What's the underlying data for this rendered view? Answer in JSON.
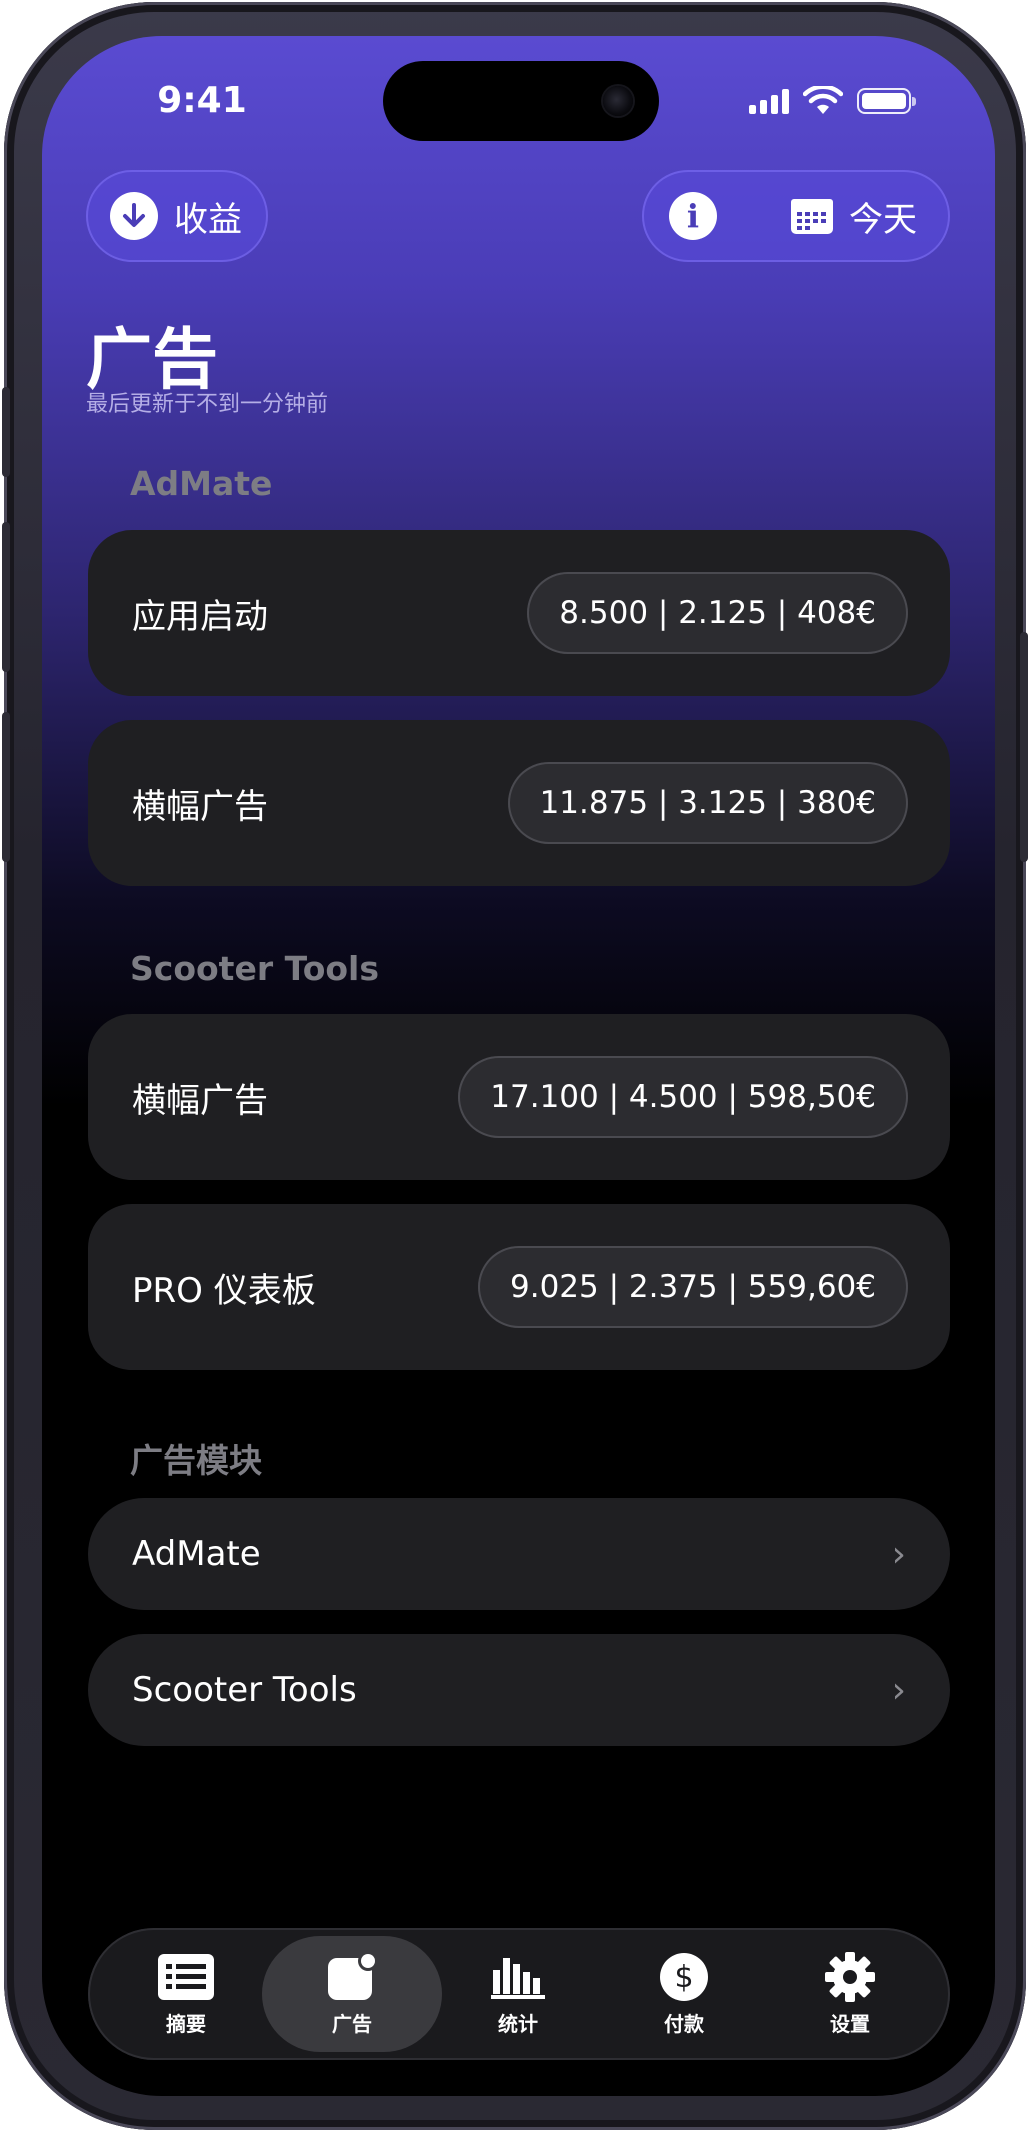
{
  "status_bar": {
    "time": "9:41"
  },
  "header": {
    "earnings_button": "收益",
    "info_button_icon": "info-icon",
    "date_button": "今天",
    "title": "广告",
    "subtitle": "最后更新于不到一分钟前"
  },
  "sections": [
    {
      "title": "AdMate",
      "rows": [
        {
          "label": "应用启动",
          "value": "8.500 | 2.125 | 408€"
        },
        {
          "label": "横幅广告",
          "value": "11.875 | 3.125 | 380€"
        }
      ]
    },
    {
      "title": "Scooter Tools",
      "rows": [
        {
          "label": "横幅广告",
          "value": "17.100 | 4.500 | 598,50€"
        },
        {
          "label": "PRO 仪表板",
          "value": "9.025 | 2.375 | 559,60€"
        }
      ]
    }
  ],
  "modules": {
    "title": "广告模块",
    "items": [
      {
        "label": "AdMate"
      },
      {
        "label": "Scooter Tools"
      }
    ]
  },
  "tabbar": {
    "tabs": [
      {
        "label": "摘要",
        "icon": "list-icon"
      },
      {
        "label": "广告",
        "icon": "ads-badge-icon",
        "active": true
      },
      {
        "label": "统计",
        "icon": "bar-chart-icon"
      },
      {
        "label": "付款",
        "icon": "dollar-icon"
      },
      {
        "label": "设置",
        "icon": "gear-icon"
      }
    ]
  },
  "colors": {
    "accent": "#5a4bd1",
    "card_bg": "#1f1f22",
    "pill_bg": "#2c2c30"
  }
}
